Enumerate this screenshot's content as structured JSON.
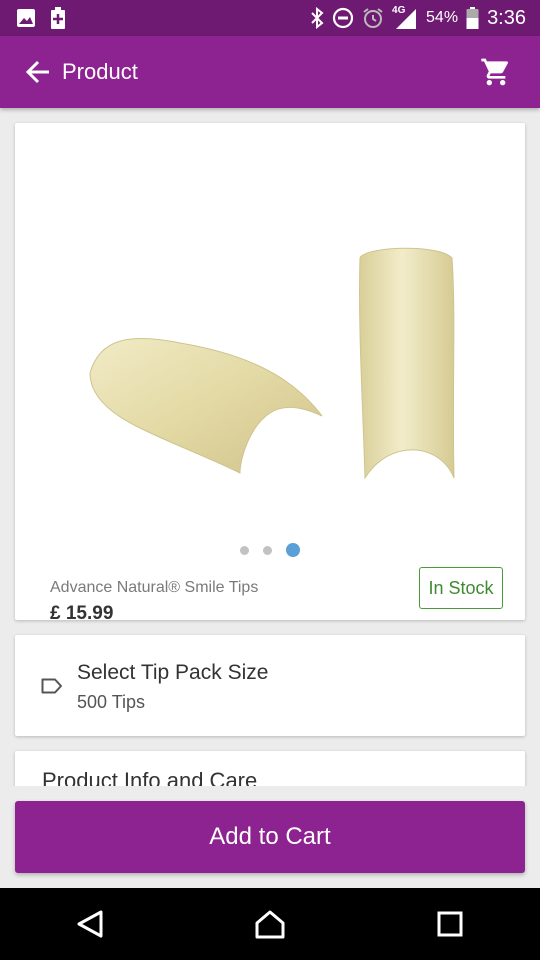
{
  "status_bar": {
    "battery_percent": "54%",
    "time": "3:36",
    "network": "4G",
    "icons": [
      "image-icon",
      "battery-saver-icon",
      "bluetooth-icon",
      "do-not-disturb-icon",
      "alarm-icon",
      "signal-icon",
      "battery-icon"
    ]
  },
  "app_bar": {
    "title": "Product",
    "back_icon": "arrow-left-icon",
    "cart_icon": "shopping-cart-icon"
  },
  "product": {
    "name": "Advance Natural® Smile Tips",
    "price": "£ 15.99",
    "stock_status": "In Stock",
    "gallery": {
      "image_count": 3,
      "active_index": 2
    }
  },
  "option": {
    "title": "Select Tip Pack Size",
    "value": "500 Tips",
    "icon": "tag-icon"
  },
  "info": {
    "title": "Product Info and Care"
  },
  "actions": {
    "add_to_cart": "Add to Cart"
  },
  "nav": {
    "icons": [
      "back-triangle-icon",
      "home-icon",
      "recents-icon"
    ]
  },
  "colors": {
    "primary": "#8d2390",
    "status_bar": "#6e1a72",
    "stock_green": "#3f8a30",
    "dot_active": "#5aa0d8"
  }
}
